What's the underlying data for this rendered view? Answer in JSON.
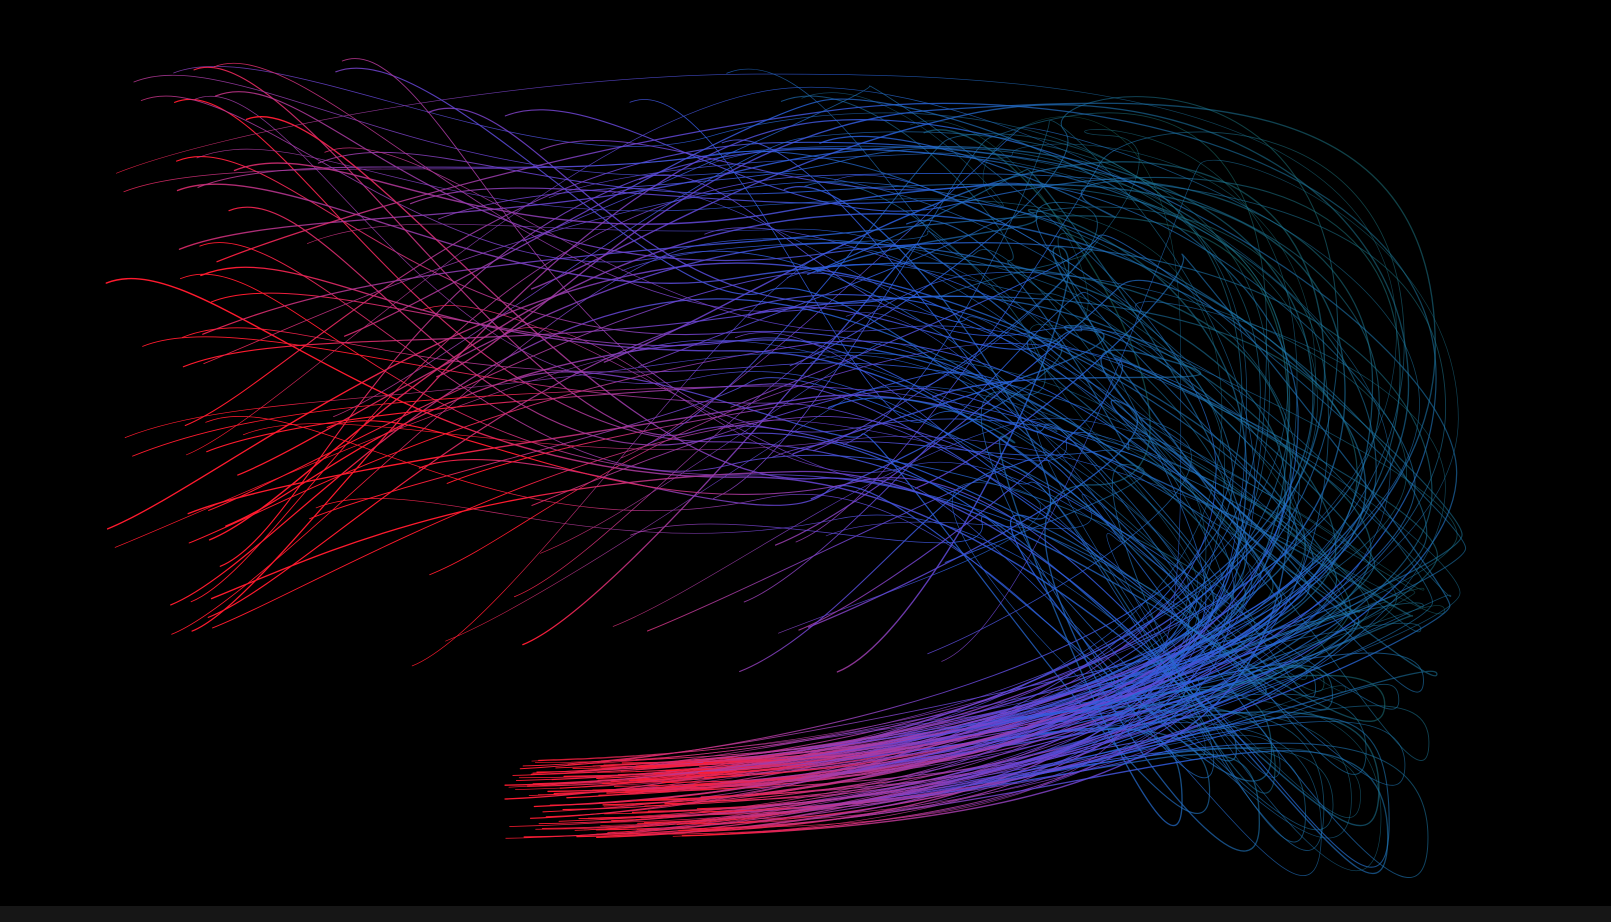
{
  "artwork": {
    "background_color": "#000000",
    "stroke_count": 140,
    "gradient_stops": [
      {
        "color": "#ff1a2e"
      },
      {
        "color": "#b8399a"
      },
      {
        "color": "#6a45d8"
      },
      {
        "color": "#2a5fe0"
      },
      {
        "color": "#1e7fb8"
      },
      {
        "color": "#1a6a4a"
      }
    ]
  },
  "bottom_bar": {
    "color": "#161616"
  }
}
